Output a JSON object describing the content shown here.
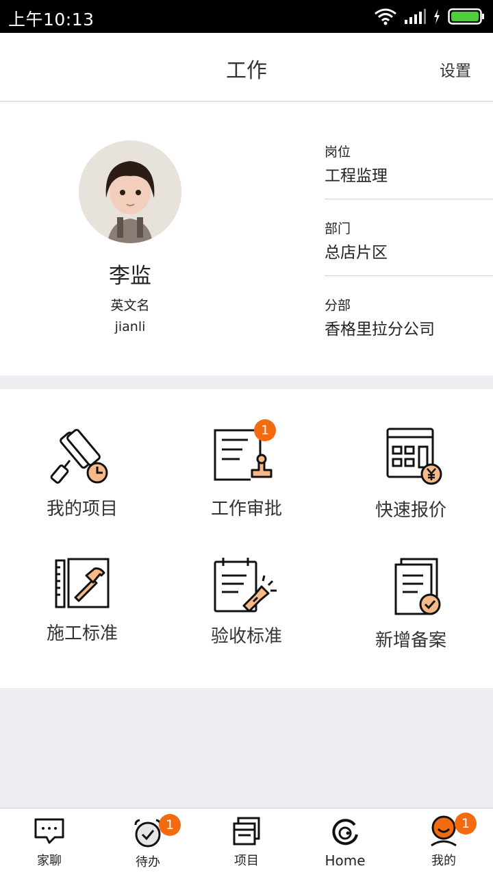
{
  "status_bar": {
    "time": "上午10:13"
  },
  "header": {
    "title": "工作",
    "settings": "设置"
  },
  "profile": {
    "name": "李监",
    "english_name_label": "英文名",
    "english_name": "jianli",
    "fields": [
      {
        "label": "岗位",
        "value": "工程监理"
      },
      {
        "label": "部门",
        "value": "总店片区"
      },
      {
        "label": "分部",
        "value": "香格里拉分公司"
      }
    ]
  },
  "menu": [
    {
      "label": "我的项目",
      "icon": "paint-roller-clock-icon"
    },
    {
      "label": "工作审批",
      "icon": "document-stamp-icon",
      "badge": "1"
    },
    {
      "label": "快速报价",
      "icon": "calculator-yen-icon"
    },
    {
      "label": "施工标准",
      "icon": "ruler-hammer-icon"
    },
    {
      "label": "验收标准",
      "icon": "notepad-flashlight-icon"
    },
    {
      "label": "新增备案",
      "icon": "documents-check-icon"
    }
  ],
  "tabs": [
    {
      "label": "家聊",
      "icon": "chat-bubble-icon"
    },
    {
      "label": "待办",
      "icon": "alarm-check-icon",
      "badge": "1"
    },
    {
      "label": "项目",
      "icon": "windows-stack-icon"
    },
    {
      "label": "Home",
      "icon": "home-logo-icon"
    },
    {
      "label": "我的",
      "icon": "user-avatar-icon",
      "badge": "1"
    }
  ],
  "colors": {
    "accent": "#f26b10",
    "icon_fill": "#f7b98a",
    "background": "#eeeef3"
  }
}
